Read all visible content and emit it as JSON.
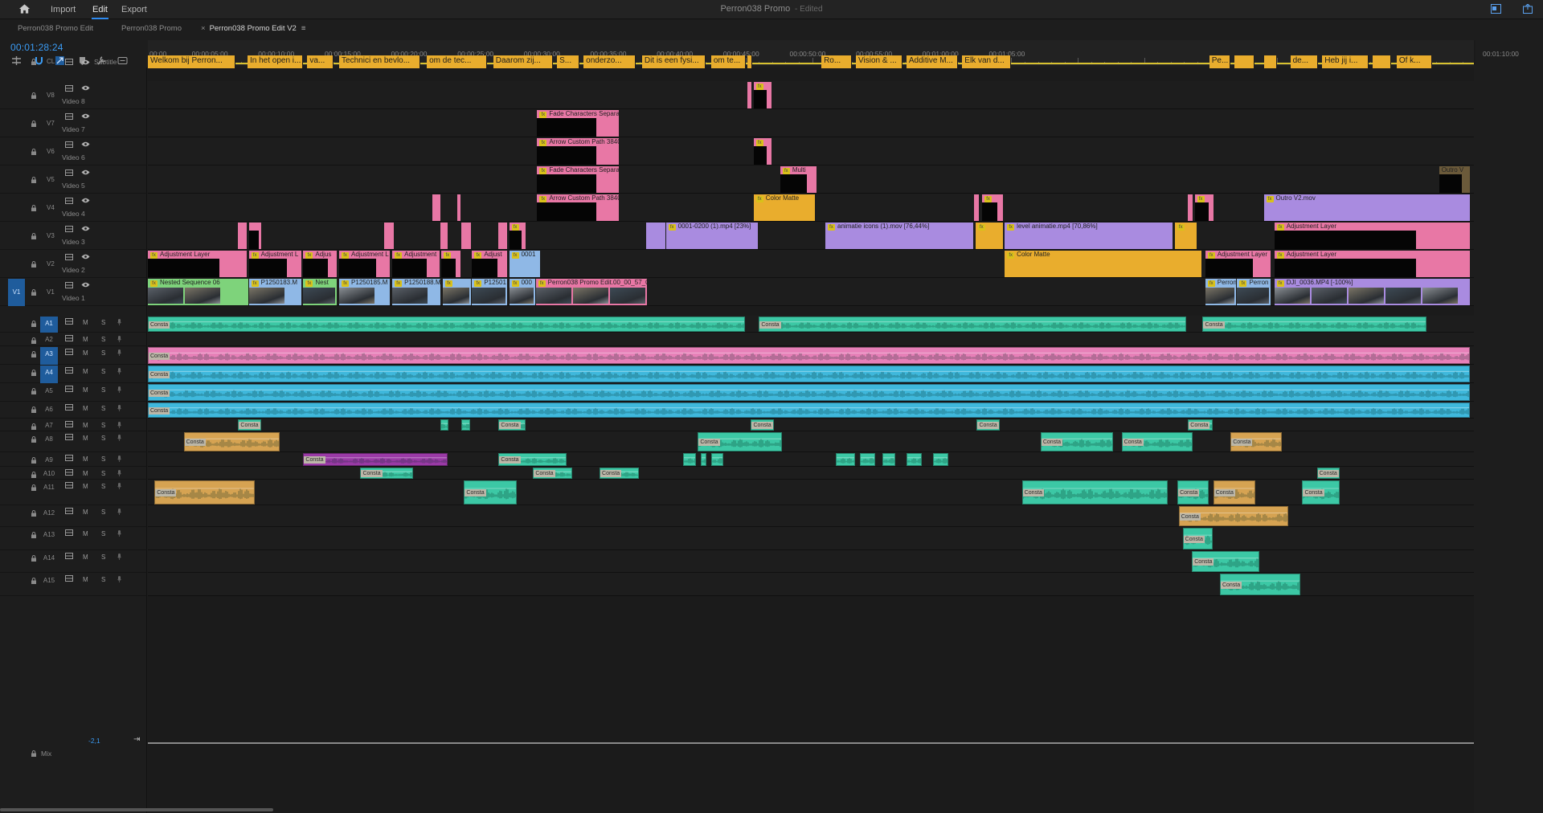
{
  "topbar": {
    "nav": [
      {
        "label": "Import"
      },
      {
        "label": "Edit"
      },
      {
        "label": "Export"
      }
    ],
    "active": "Edit",
    "title": "Perron038 Promo",
    "title_status": " - Edited"
  },
  "tabs": [
    {
      "label": "Perron038 Promo Edit",
      "active": false
    },
    {
      "label": "Perron038 Promo",
      "active": false
    },
    {
      "label": "Perron038 Promo Edit V2",
      "active": true,
      "close": "×",
      "menu": "≡"
    }
  ],
  "timecode": "00:01:28:24",
  "ruler": {
    "labels": [
      "00:00",
      "00:00:05:00",
      "00:00:10:00",
      "00:00:15:00",
      "00:00:20:00",
      "00:00:25:00",
      "00:00:30:00",
      "00:00:35:00",
      "00:00:40:00",
      "00:00:45:00",
      "00:00:50:00",
      "00:00:55:00",
      "00:01:00:00",
      "00:01:05:00"
    ],
    "end_label": "00:01:10:00"
  },
  "tracks": {
    "subtitle": {
      "id": "CL",
      "name": "Subtitle"
    },
    "video": [
      {
        "id": "V8",
        "name": "Video 8"
      },
      {
        "id": "V7",
        "name": "Video 7"
      },
      {
        "id": "V6",
        "name": "Video 6"
      },
      {
        "id": "V5",
        "name": "Video 5"
      },
      {
        "id": "V4",
        "name": "Video 4"
      },
      {
        "id": "V3",
        "name": "Video 3"
      },
      {
        "id": "V2",
        "name": "Video 2"
      },
      {
        "id": "V1",
        "name": "Video 1",
        "source": "V1"
      }
    ],
    "audio": [
      {
        "id": "A1",
        "targeted": true
      },
      {
        "id": "A2",
        "targeted": false
      },
      {
        "id": "A3",
        "targeted": true
      },
      {
        "id": "A4",
        "targeted": true
      },
      {
        "id": "A5",
        "targeted": false
      },
      {
        "id": "A6",
        "targeted": false
      },
      {
        "id": "A7",
        "targeted": false
      },
      {
        "id": "A8",
        "targeted": false
      },
      {
        "id": "A9",
        "targeted": false
      },
      {
        "id": "A10",
        "targeted": false
      },
      {
        "id": "A11",
        "targeted": false
      },
      {
        "id": "A12",
        "targeted": false
      },
      {
        "id": "A13",
        "targeted": false
      },
      {
        "id": "A14",
        "targeted": false
      },
      {
        "id": "A15",
        "targeted": false
      }
    ],
    "mute_label": "M",
    "solo_label": "S",
    "mix": {
      "name": "Mix",
      "db": "-2,1"
    }
  },
  "subtitles": [
    {
      "text": "Welkom bij Perron...",
      "s": 0.0,
      "e": 6.6
    },
    {
      "text": "In het open i...",
      "s": 7.5,
      "e": 11.7
    },
    {
      "text": "va...",
      "s": 12.0,
      "e": 14.0
    },
    {
      "text": "Technici en bevlo...",
      "s": 14.4,
      "e": 20.5
    },
    {
      "text": "om de tec...",
      "s": 21.0,
      "e": 25.5
    },
    {
      "text": "Daarom zij...",
      "s": 26.0,
      "e": 30.5
    },
    {
      "text": "S...",
      "s": 30.8,
      "e": 32.5
    },
    {
      "text": "onderzo...",
      "s": 32.8,
      "e": 36.7
    },
    {
      "text": "Dit is een fysi...",
      "s": 37.2,
      "e": 42.0
    },
    {
      "text": "om te...",
      "s": 42.4,
      "e": 45.0
    },
    {
      "text": "",
      "s": 45.1,
      "e": 45.5
    },
    {
      "text": "Ro...",
      "s": 50.7,
      "e": 53.0
    },
    {
      "text": "Vision & ...",
      "s": 53.3,
      "e": 56.8
    },
    {
      "text": "Additive M...",
      "s": 57.1,
      "e": 61.0
    },
    {
      "text": "Elk van d...",
      "s": 61.3,
      "e": 65.0
    },
    {
      "text": "Pe...",
      "s": 79.9,
      "e": 81.5
    },
    {
      "text": "",
      "s": 81.8,
      "e": 83.3
    },
    {
      "text": "",
      "s": 84.0,
      "e": 85.0
    },
    {
      "text": "de...",
      "s": 86.0,
      "e": 88.1
    },
    {
      "text": "Heb jij i...",
      "s": 88.4,
      "e": 91.9
    },
    {
      "text": "",
      "s": 92.2,
      "e": 93.6
    },
    {
      "text": "Of k...",
      "s": 94.0,
      "e": 96.7
    }
  ],
  "video_clips": {
    "V8": [
      {
        "label": "",
        "s": 45.1,
        "e": 45.5,
        "color": "#e877a5"
      },
      {
        "label": "",
        "s": 45.6,
        "e": 47.0,
        "color": "#e877a5",
        "fx": true,
        "frame": true
      }
    ],
    "V7": [
      {
        "label": "Fade Characters Separate",
        "s": 29.3,
        "e": 35.5,
        "color": "#e877a5",
        "fx": true,
        "frame": true
      }
    ],
    "V6": [
      {
        "label": "Arrow Custom Path 3840",
        "s": 29.3,
        "e": 35.5,
        "color": "#e877a5",
        "fx": true,
        "frame": true
      },
      {
        "label": "",
        "s": 45.6,
        "e": 47.0,
        "color": "#e877a5",
        "fx": true,
        "frame": true
      }
    ],
    "V5": [
      {
        "label": "Fade Characters Separate",
        "s": 29.3,
        "e": 35.5,
        "color": "#e877a5",
        "fx": true,
        "frame": true
      },
      {
        "label": "Multi",
        "s": 47.6,
        "e": 50.4,
        "color": "#e877a5",
        "fx": true,
        "frame": true
      },
      {
        "label": "Outro V",
        "s": 97.2,
        "e": 99.6,
        "color": "#6b5a3a",
        "frame": true
      }
    ],
    "V4": [
      {
        "label": "",
        "s": 21.4,
        "e": 22.1,
        "color": "#e877a5"
      },
      {
        "label": "",
        "s": 23.3,
        "e": 23.6,
        "color": "#e877a5"
      },
      {
        "label": "Arrow Custom Path 3840",
        "s": 29.3,
        "e": 35.5,
        "color": "#e877a5",
        "fx": true,
        "frame": true
      },
      {
        "label": "Color Matte",
        "s": 45.6,
        "e": 50.3,
        "color": "#e9ad2d",
        "fx": true
      },
      {
        "label": "",
        "s": 62.2,
        "e": 62.6,
        "color": "#e877a5"
      },
      {
        "label": "",
        "s": 62.8,
        "e": 64.4,
        "color": "#e877a5",
        "fx": true,
        "frame": true
      },
      {
        "label": "",
        "s": 78.3,
        "e": 78.7,
        "color": "#e877a5"
      },
      {
        "label": "",
        "s": 78.8,
        "e": 80.3,
        "color": "#e877a5",
        "fx": true,
        "frame": true
      },
      {
        "label": "Outro V2.mov",
        "s": 84.0,
        "e": 99.6,
        "color": "#a98be0",
        "fx": true
      }
    ],
    "V3": [
      {
        "label": "",
        "s": 6.8,
        "e": 7.5,
        "color": "#e877a5"
      },
      {
        "label": "",
        "s": 7.6,
        "e": 8.6,
        "color": "#e877a5",
        "frame": true
      },
      {
        "label": "",
        "s": 17.8,
        "e": 18.6,
        "color": "#e877a5"
      },
      {
        "label": "",
        "s": 22.0,
        "e": 22.6,
        "color": "#e877a5"
      },
      {
        "label": "",
        "s": 23.6,
        "e": 24.4,
        "color": "#e877a5"
      },
      {
        "label": "",
        "s": 26.4,
        "e": 27.1,
        "color": "#e877a5"
      },
      {
        "label": "",
        "s": 27.2,
        "e": 28.5,
        "color": "#e877a5",
        "fx": true,
        "frame": true
      },
      {
        "label": "",
        "s": 37.5,
        "e": 39.0,
        "color": "#a98be0"
      },
      {
        "label": "0001-0200 (1).mp4 [23%]",
        "s": 39.0,
        "e": 46.0,
        "color": "#a98be0",
        "fx": true
      },
      {
        "label": "animatie icons (1).mov [76,44%]",
        "s": 51.0,
        "e": 62.2,
        "color": "#a98be0",
        "fx": true
      },
      {
        "label": "",
        "s": 62.3,
        "e": 64.4,
        "color": "#e9ad2d",
        "fx": true
      },
      {
        "label": "level animatie.mp4 [70,86%]",
        "s": 64.5,
        "e": 77.2,
        "color": "#a98be0",
        "fx": true
      },
      {
        "label": "",
        "s": 77.3,
        "e": 79.0,
        "color": "#e9ad2d",
        "fx": true
      },
      {
        "label": "Adjustment Layer",
        "s": 84.8,
        "e": 99.6,
        "color": "#e877a5",
        "fx": true,
        "frame": true
      }
    ],
    "V2": [
      {
        "label": "Adjustment Layer",
        "s": 0.0,
        "e": 7.5,
        "color": "#e877a5",
        "fx": true,
        "frame": true
      },
      {
        "label": "Adjustment L",
        "s": 7.6,
        "e": 11.6,
        "color": "#e877a5",
        "fx": true,
        "frame": true
      },
      {
        "label": "Adjus",
        "s": 11.7,
        "e": 14.3,
        "color": "#e877a5",
        "fx": true,
        "frame": true
      },
      {
        "label": "Adjustment L",
        "s": 14.4,
        "e": 18.3,
        "color": "#e877a5",
        "fx": true,
        "frame": true
      },
      {
        "label": "Adjustment",
        "s": 18.4,
        "e": 22.0,
        "color": "#e877a5",
        "fx": true,
        "frame": true
      },
      {
        "label": "",
        "s": 22.1,
        "e": 23.6,
        "color": "#e877a5",
        "fx": true,
        "frame": true
      },
      {
        "label": "Adjust",
        "s": 24.4,
        "e": 27.1,
        "color": "#e877a5",
        "fx": true,
        "frame": true
      },
      {
        "label": "0001",
        "s": 27.2,
        "e": 29.6,
        "color": "#8fb8e6",
        "fx": true
      },
      {
        "label": "Color Matte",
        "s": 64.5,
        "e": 79.4,
        "color": "#e9ad2d",
        "fx": true
      },
      {
        "label": "Adjustment Layer",
        "s": 79.6,
        "e": 84.6,
        "color": "#e877a5",
        "fx": true,
        "frame": true
      },
      {
        "label": "Adjustment Layer",
        "s": 84.8,
        "e": 99.6,
        "color": "#e877a5",
        "fx": true,
        "frame": true
      }
    ],
    "V1": [
      {
        "label": "Nested Sequence 06",
        "s": 0.0,
        "e": 7.6,
        "color": "#7ed37b",
        "fx": true,
        "thumb": true
      },
      {
        "label": "P1250183.M",
        "s": 7.6,
        "e": 11.6,
        "color": "#8fb8e6",
        "fx": true,
        "thumb": true
      },
      {
        "label": "Nest",
        "s": 11.7,
        "e": 14.3,
        "color": "#7ed37b",
        "fx": true,
        "thumb": true
      },
      {
        "label": "P1250185.M",
        "s": 14.4,
        "e": 18.3,
        "color": "#8fb8e6",
        "fx": true,
        "thumb": true
      },
      {
        "label": "P1250188.M",
        "s": 18.4,
        "e": 22.1,
        "color": "#8fb8e6",
        "fx": true,
        "thumb": true
      },
      {
        "label": "",
        "s": 22.2,
        "e": 24.4,
        "color": "#8fb8e6",
        "fx": true,
        "thumb": true
      },
      {
        "label": "P12501",
        "s": 24.4,
        "e": 27.1,
        "color": "#8fb8e6",
        "fx": true,
        "thumb": true
      },
      {
        "label": "000",
        "s": 27.2,
        "e": 29.2,
        "color": "#8fb8e6",
        "fx": true,
        "thumb": true
      },
      {
        "label": "Perron038 Promo Edit.00_00_57_0",
        "s": 29.2,
        "e": 37.6,
        "color": "#e877a5",
        "fx": true,
        "thumb": true
      },
      {
        "label": "Perron",
        "s": 79.6,
        "e": 82.0,
        "color": "#8fb8e6",
        "fx": true,
        "thumb": true
      },
      {
        "label": "Perron",
        "s": 82.0,
        "e": 84.6,
        "color": "#8fb8e6",
        "fx": true,
        "thumb": true
      },
      {
        "label": "DJI_0036.MP4 [-100%]",
        "s": 84.8,
        "e": 99.6,
        "color": "#a98be0",
        "fx": true,
        "thumb": true
      }
    ]
  },
  "audio_clips": {
    "A1": [
      {
        "s": 0.0,
        "e": 45.0,
        "color": "#3cc8a5",
        "label": "Consta"
      },
      {
        "s": 46.0,
        "e": 78.2,
        "color": "#3cc8a5",
        "label": "Consta"
      },
      {
        "s": 79.4,
        "e": 96.3,
        "color": "#3cc8a5",
        "label": "Consta"
      }
    ],
    "A3": [
      {
        "s": 0.0,
        "e": 99.6,
        "color": "#e780b8",
        "label": "Consta"
      }
    ],
    "A4": [
      {
        "s": 0.0,
        "e": 99.6,
        "color": "#3fb8dc",
        "label": "Consta"
      }
    ],
    "A5": [
      {
        "s": 0.0,
        "e": 99.6,
        "color": "#3fb8dc",
        "label": "Consta"
      }
    ],
    "A6": [
      {
        "s": 0.0,
        "e": 99.6,
        "color": "#3fb8dc",
        "label": "Consta"
      }
    ],
    "A7": [
      {
        "s": 6.8,
        "e": 8.6,
        "color": "#3cc8a5",
        "label": "Consta"
      },
      {
        "s": 22.0,
        "e": 22.7,
        "color": "#3cc8a5",
        "label": ""
      },
      {
        "s": 23.6,
        "e": 24.3,
        "color": "#3cc8a5",
        "label": ""
      },
      {
        "s": 26.4,
        "e": 28.5,
        "color": "#3cc8a5",
        "label": "Consta"
      },
      {
        "s": 45.4,
        "e": 47.2,
        "color": "#3cc8a5",
        "label": "Consta"
      },
      {
        "s": 62.4,
        "e": 64.2,
        "color": "#3cc8a5",
        "label": "Consta"
      },
      {
        "s": 78.3,
        "e": 80.2,
        "color": "#3cc8a5",
        "label": "Consta"
      }
    ],
    "A8": [
      {
        "s": 2.7,
        "e": 10.0,
        "color": "#d6a352",
        "label": "Consta"
      },
      {
        "s": 41.4,
        "e": 47.8,
        "color": "#3cc8a5",
        "label": "Consta"
      },
      {
        "s": 67.2,
        "e": 72.7,
        "color": "#3cc8a5",
        "label": "Consta"
      },
      {
        "s": 73.3,
        "e": 78.7,
        "color": "#3cc8a5",
        "label": "Consta"
      },
      {
        "s": 81.5,
        "e": 85.4,
        "color": "#d6a352",
        "label": "Consta"
      }
    ],
    "A9": [
      {
        "s": 11.7,
        "e": 22.6,
        "color": "#9a3aa6",
        "label": "Consta"
      },
      {
        "s": 26.4,
        "e": 31.6,
        "color": "#3cc8a5",
        "label": "Consta"
      },
      {
        "s": 40.3,
        "e": 41.3,
        "color": "#3cc8a5",
        "label": ""
      },
      {
        "s": 41.6,
        "e": 42.1,
        "color": "#3cc8a5",
        "label": ""
      },
      {
        "s": 42.4,
        "e": 43.4,
        "color": "#3cc8a5",
        "label": ""
      },
      {
        "s": 51.8,
        "e": 53.3,
        "color": "#3cc8a5",
        "label": ""
      },
      {
        "s": 53.6,
        "e": 54.8,
        "color": "#3cc8a5",
        "label": ""
      },
      {
        "s": 55.3,
        "e": 56.3,
        "color": "#3cc8a5",
        "label": ""
      },
      {
        "s": 57.1,
        "e": 58.3,
        "color": "#3cc8a5",
        "label": ""
      },
      {
        "s": 59.1,
        "e": 60.3,
        "color": "#3cc8a5",
        "label": ""
      }
    ],
    "A10": [
      {
        "s": 16.0,
        "e": 20.0,
        "color": "#3cc8a5",
        "label": "Consta"
      },
      {
        "s": 29.0,
        "e": 32.0,
        "color": "#3cc8a5",
        "label": "Consta"
      },
      {
        "s": 34.0,
        "e": 37.0,
        "color": "#3cc8a5",
        "label": "Consta"
      },
      {
        "s": 88.0,
        "e": 89.8,
        "color": "#3cc8a5",
        "label": "Consta"
      }
    ],
    "A11": [
      {
        "s": 0.5,
        "e": 8.1,
        "color": "#d6a352",
        "label": "Consta"
      },
      {
        "s": 23.8,
        "e": 27.8,
        "color": "#3cc8a5",
        "label": "Consta"
      },
      {
        "s": 65.8,
        "e": 76.8,
        "color": "#3cc8a5",
        "label": "Consta"
      },
      {
        "s": 77.5,
        "e": 79.9,
        "color": "#3cc8a5",
        "label": "Consta"
      },
      {
        "s": 80.2,
        "e": 83.4,
        "color": "#d6a352",
        "label": "Consta"
      },
      {
        "s": 86.9,
        "e": 89.8,
        "color": "#3cc8a5",
        "label": "Consta"
      }
    ],
    "A12": [
      {
        "s": 77.6,
        "e": 85.9,
        "color": "#d6a352",
        "label": "Consta"
      }
    ],
    "A13": [
      {
        "s": 77.9,
        "e": 80.2,
        "color": "#3cc8a5",
        "label": "Consta"
      }
    ],
    "A14": [
      {
        "s": 78.6,
        "e": 83.7,
        "color": "#3cc8a5",
        "label": "Consta"
      }
    ],
    "A15": [
      {
        "s": 80.7,
        "e": 86.8,
        "color": "#3cc8a5",
        "label": "Consta"
      }
    ]
  }
}
